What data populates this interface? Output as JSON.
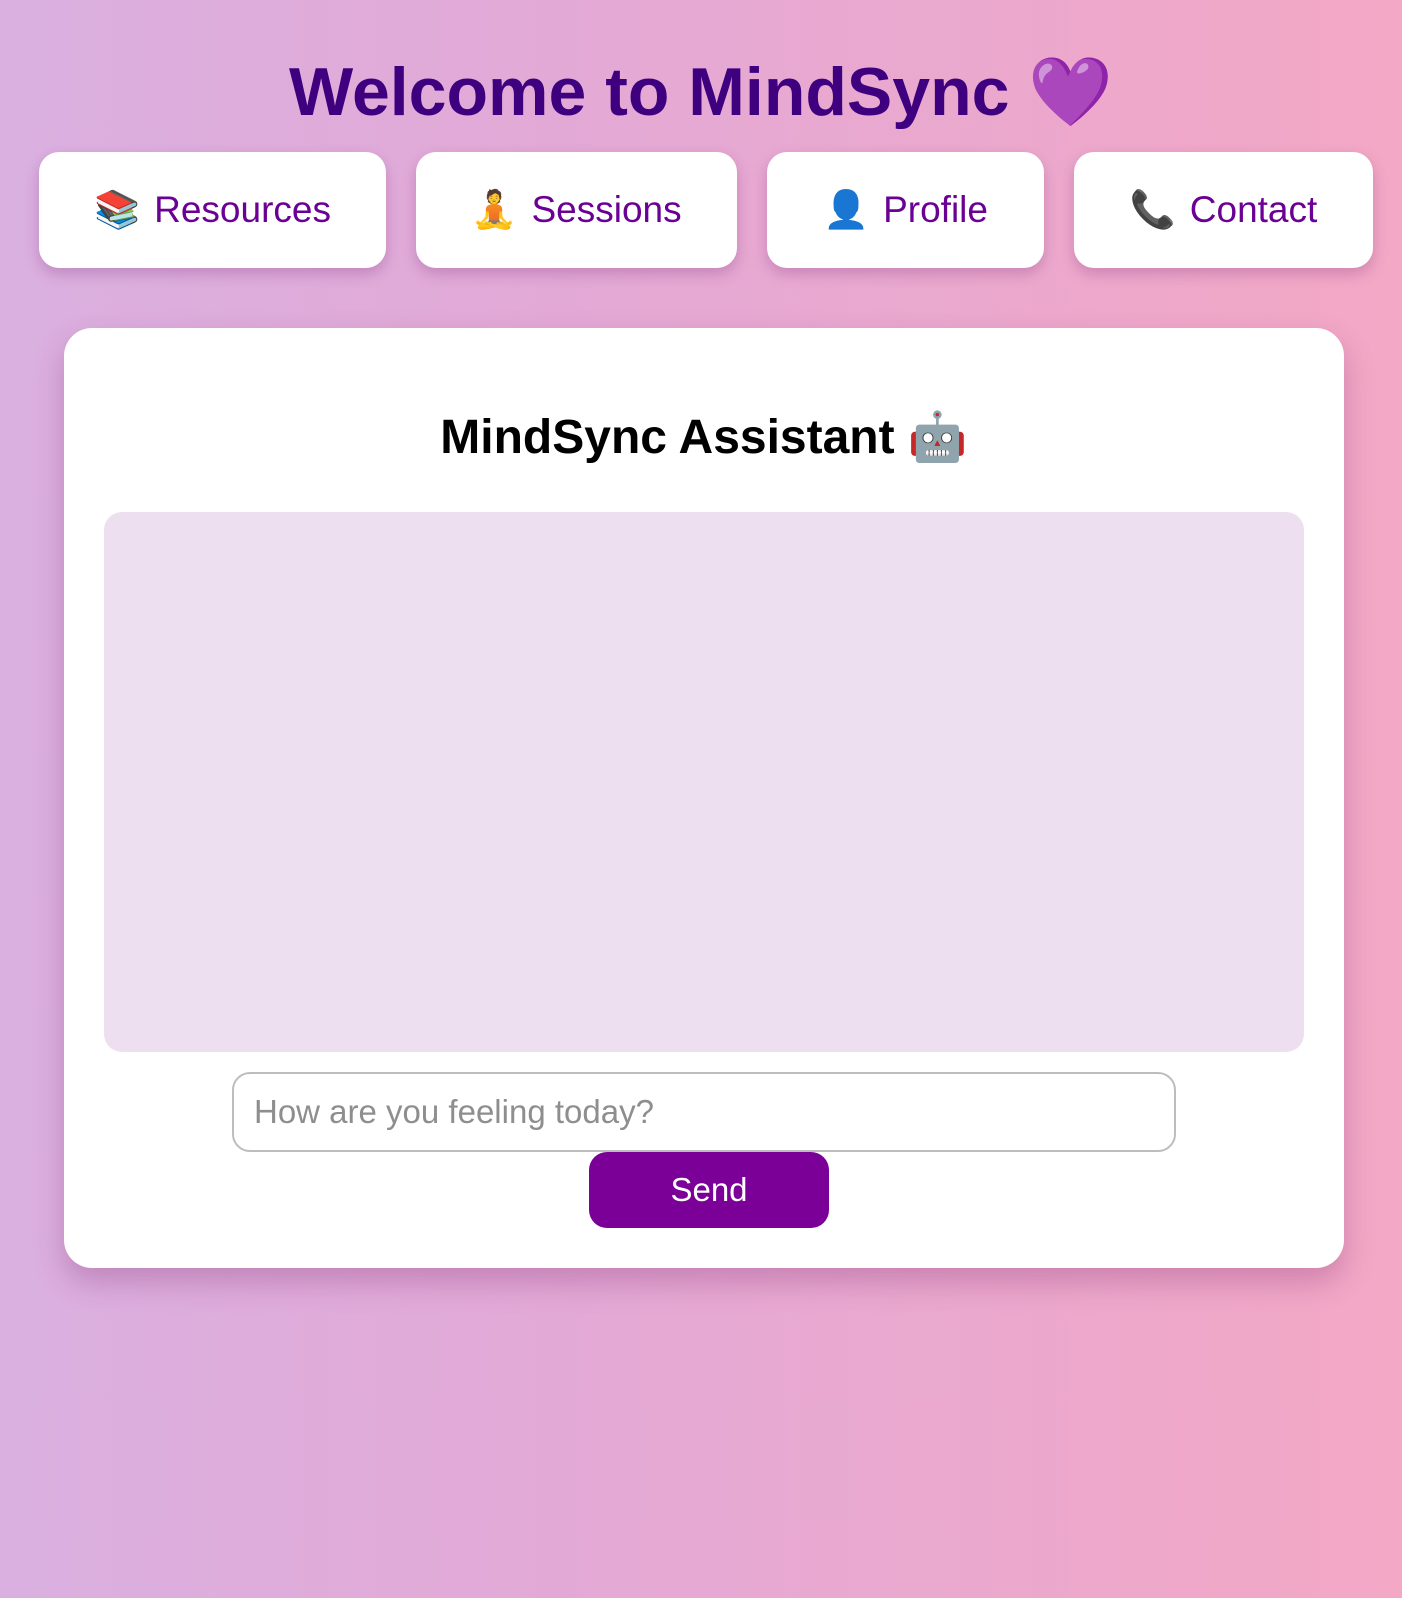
{
  "header": {
    "title": "Welcome to MindSync 💜"
  },
  "nav": [
    {
      "icon": "📚",
      "icon_name": "books-icon",
      "label": "Resources"
    },
    {
      "icon": "🧘",
      "icon_name": "meditation-icon",
      "label": "Sessions"
    },
    {
      "icon": "👤",
      "icon_name": "user-icon",
      "label": "Profile"
    },
    {
      "icon": "📞",
      "icon_name": "phone-icon",
      "label": "Contact"
    }
  ],
  "assistant": {
    "title": "MindSync Assistant 🤖",
    "input_placeholder": "How are you feeling today?",
    "input_value": "",
    "send_label": "Send"
  },
  "colors": {
    "title": "#3f0080",
    "nav_text": "#6a0094",
    "send_button": "#7a0098",
    "chat_background": "#eedff0"
  }
}
